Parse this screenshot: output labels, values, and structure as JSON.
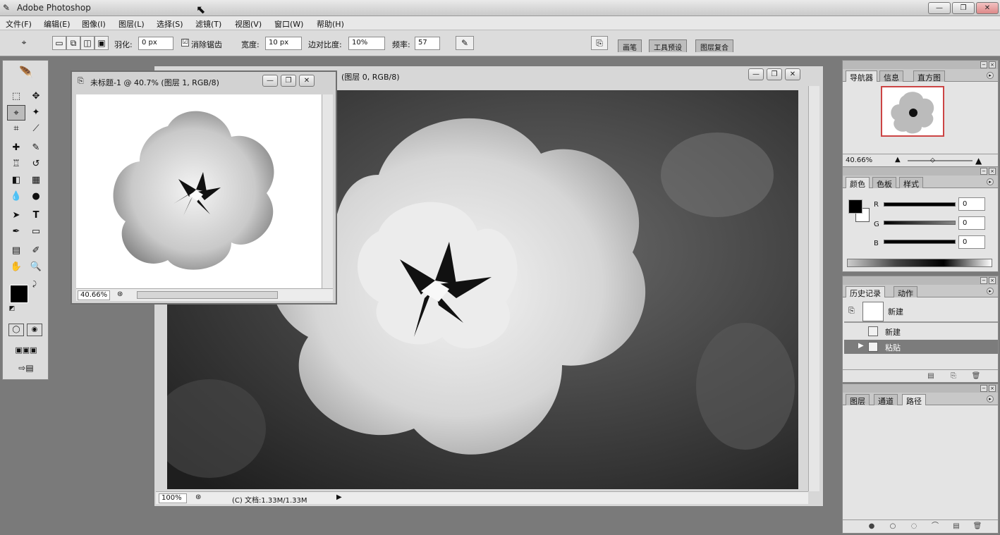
{
  "app": {
    "title": "Adobe Photoshop"
  },
  "window_controls": {
    "minimize": "—",
    "restore": "❐",
    "close": "✕"
  },
  "menu": [
    "文件(F)",
    "编辑(E)",
    "图像(I)",
    "图层(L)",
    "选择(S)",
    "滤镜(T)",
    "视图(V)",
    "窗口(W)",
    "帮助(H)"
  ],
  "options": {
    "feather_label": "羽化:",
    "feather_value": "0 px",
    "antialias_label": "消除锯齿",
    "antialias_checked": "☑",
    "width_label": "宽度:",
    "width_value": "10 px",
    "edge_contrast_label": "边对比度:",
    "edge_contrast_value": "10%",
    "frequency_label": "频率:",
    "frequency_value": "57",
    "palette_well_tabs": [
      "画笔",
      "工具预设",
      "图层复合"
    ]
  },
  "documents": {
    "main": {
      "title": "(图层 0, RGB/8)",
      "zoom": "100%",
      "doc_size": "(C) 文档:1.33M/1.33M"
    },
    "small": {
      "title": "未标题-1 @ 40.7% (图层 1, RGB/8)",
      "zoom": "40.66%"
    }
  },
  "navigator": {
    "tabs": [
      "导航器",
      "信息",
      "直方图"
    ],
    "zoom": "40.66%"
  },
  "color_panel": {
    "tabs": [
      "颜色",
      "色板",
      "样式"
    ],
    "channels": [
      {
        "label": "R",
        "value": "0"
      },
      {
        "label": "G",
        "value": "0"
      },
      {
        "label": "B",
        "value": "0"
      }
    ]
  },
  "history": {
    "tabs": [
      "历史记录",
      "动作"
    ],
    "snapshot_label": "新建",
    "items": [
      {
        "label": "新建",
        "selected": false
      },
      {
        "label": "粘贴",
        "selected": true
      }
    ]
  },
  "layers_panel": {
    "tabs": [
      "图层",
      "通道",
      "路径"
    ]
  },
  "icons": [
    "lasso-icon",
    "marquee-icon",
    "move-icon",
    "magnetic-lasso-icon",
    "magic-wand-icon",
    "crop-icon",
    "slice-icon",
    "healing-brush-icon",
    "brush-icon",
    "clone-stamp-icon",
    "history-brush-icon",
    "eraser-icon",
    "gradient-icon",
    "blur-icon",
    "dodge-icon",
    "path-select-icon",
    "type-icon",
    "pen-icon",
    "shape-icon",
    "notes-icon",
    "eyedropper-icon",
    "hand-icon",
    "zoom-icon",
    "palette-well-icon"
  ]
}
